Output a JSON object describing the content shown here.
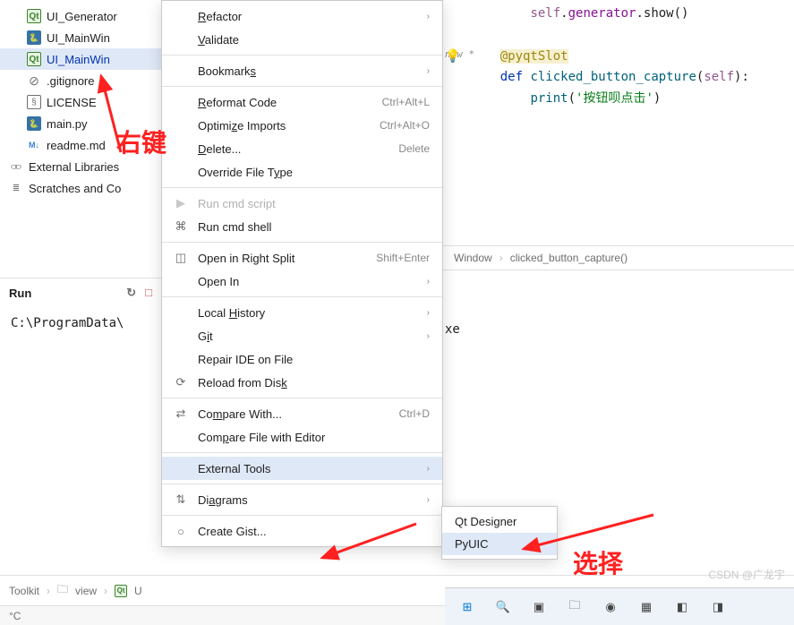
{
  "tree": {
    "files": [
      {
        "name": "UI_Generator",
        "icon": "qt"
      },
      {
        "name": "UI_MainWin",
        "icon": "py"
      },
      {
        "name": "UI_MainWin",
        "icon": "qt",
        "selected": true
      },
      {
        "name": ".gitignore",
        "icon": "gitignore"
      },
      {
        "name": "LICENSE",
        "icon": "lic"
      },
      {
        "name": "main.py",
        "icon": "py"
      },
      {
        "name": "readme.md",
        "icon": "md"
      }
    ],
    "external": "External Libraries",
    "scratches": "Scratches and Co"
  },
  "menu": {
    "items": [
      {
        "type": "item",
        "label_pre": "",
        "u": "R",
        "label_post": "efactor",
        "arrow": true
      },
      {
        "type": "item",
        "label_pre": "",
        "u": "V",
        "label_post": "alidate"
      },
      {
        "type": "sep"
      },
      {
        "type": "item",
        "label_pre": "Bookmark",
        "u": "s",
        "label_post": "",
        "arrow": true
      },
      {
        "type": "sep"
      },
      {
        "type": "item",
        "label_pre": "",
        "u": "R",
        "label_post": "eformat Code",
        "shortcut": "Ctrl+Alt+L"
      },
      {
        "type": "item",
        "label_pre": "Optimi",
        "u": "z",
        "label_post": "e Imports",
        "shortcut": "Ctrl+Alt+O"
      },
      {
        "type": "item",
        "label_pre": "",
        "u": "D",
        "label_post": "elete...",
        "shortcut": "Delete"
      },
      {
        "type": "item",
        "label_pre": "Override File T",
        "u": "y",
        "label_post": "pe"
      },
      {
        "type": "sep"
      },
      {
        "type": "item",
        "icon": "run",
        "label_pre": "Run cmd script",
        "disabled": true
      },
      {
        "type": "item",
        "icon": "cmd",
        "label_pre": "Run cmd shell"
      },
      {
        "type": "sep"
      },
      {
        "type": "item",
        "icon": "split",
        "label_pre": "Open in Right Split",
        "shortcut": "Shift+Enter"
      },
      {
        "type": "item",
        "label_pre": "Open In",
        "arrow": true
      },
      {
        "type": "sep"
      },
      {
        "type": "item",
        "label_pre": "Local ",
        "u": "H",
        "label_post": "istory",
        "arrow": true
      },
      {
        "type": "item",
        "label_pre": "G",
        "u": "i",
        "label_post": "t",
        "arrow": true
      },
      {
        "type": "item",
        "label_pre": "Repair IDE on File"
      },
      {
        "type": "item",
        "icon": "reload",
        "label_pre": "Reload from Dis",
        "u": "k",
        "label_post": ""
      },
      {
        "type": "sep"
      },
      {
        "type": "item",
        "icon": "compare",
        "label_pre": "Co",
        "u": "m",
        "label_post": "pare With...",
        "shortcut": "Ctrl+D"
      },
      {
        "type": "item",
        "label_pre": "Com",
        "u": "p",
        "label_post": "are File with Editor"
      },
      {
        "type": "sep"
      },
      {
        "type": "item",
        "label_pre": "External Tools",
        "arrow": true,
        "highlighted": true
      },
      {
        "type": "sep"
      },
      {
        "type": "item",
        "icon": "diagram",
        "label_pre": "Di",
        "u": "a",
        "label_post": "grams",
        "arrow": true
      },
      {
        "type": "sep"
      },
      {
        "type": "item",
        "icon": "gist",
        "label_pre": "Create Gist..."
      }
    ]
  },
  "submenu": {
    "items": [
      {
        "label": "Qt Designer"
      },
      {
        "label": "PyUIC",
        "highlighted": true
      }
    ]
  },
  "code": {
    "l1_self": "self",
    "l1_gen": "generator",
    "l1_show": "show",
    "l2_new": "new *",
    "l3_deco": "@pyqtSlot",
    "l4_def": "def",
    "l4_fn": "clicked_button_capture",
    "l4_self": "self",
    "l5_print": "print",
    "l5_str": "'按钮呗点击'"
  },
  "breadcrumb": {
    "b1": "Window",
    "b2": "clicked_button_capture()"
  },
  "run": {
    "title": "Run",
    "output": "C:\\ProgramData\\"
  },
  "xe": "xe",
  "bottom_crumb": {
    "c1": "Toolkit",
    "c2": "view",
    "c3": "U"
  },
  "status": {
    "temp": "°C"
  },
  "annotations": {
    "rightclick": "右键",
    "select": "选择"
  },
  "watermark": "CSDN @广龙宇"
}
